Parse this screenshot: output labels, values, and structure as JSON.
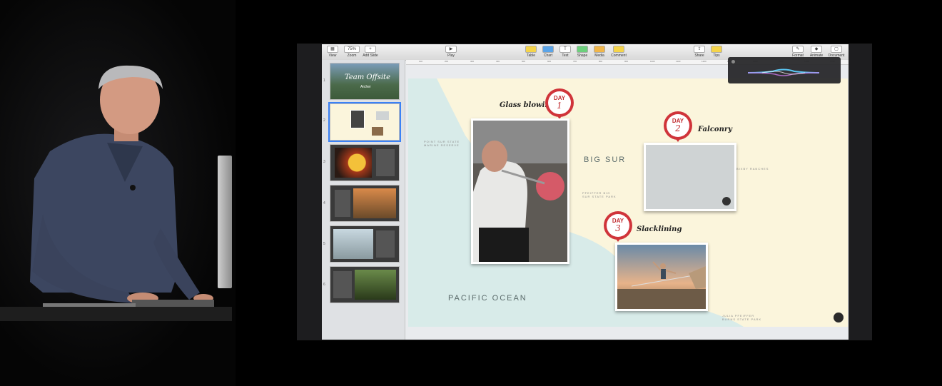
{
  "toolbar": {
    "left": [
      {
        "label": "View",
        "icon": "view-icon"
      },
      {
        "label": "Zoom",
        "value": "75%"
      },
      {
        "label": "Add Slide",
        "icon": "plus-icon"
      }
    ],
    "center_play": {
      "label": "Play",
      "icon": "play-icon"
    },
    "insert": [
      {
        "label": "Table",
        "icon": "table-icon"
      },
      {
        "label": "Chart",
        "icon": "chart-icon"
      },
      {
        "label": "Text",
        "icon": "text-icon",
        "glyph": "T"
      },
      {
        "label": "Shape",
        "icon": "shape-icon"
      },
      {
        "label": "Media",
        "icon": "media-icon"
      },
      {
        "label": "Comment",
        "icon": "comment-icon"
      }
    ],
    "right": [
      {
        "label": "Share",
        "icon": "share-icon"
      },
      {
        "label": "Tips",
        "icon": "tips-icon"
      }
    ],
    "inspector": [
      {
        "label": "Format",
        "icon": "format-icon"
      },
      {
        "label": "Animate",
        "icon": "animate-icon"
      },
      {
        "label": "Document",
        "icon": "document-icon"
      }
    ]
  },
  "ruler": {
    "ticks": [
      "100",
      "200",
      "300",
      "400",
      "500",
      "600",
      "700",
      "800",
      "900",
      "1000",
      "1100",
      "1200",
      "1300",
      "1400",
      "1500",
      "1600",
      "1700"
    ]
  },
  "navigator": {
    "slides": [
      {
        "number": "1",
        "title": "Team Offsite",
        "subtitle": "Archer"
      },
      {
        "number": "2"
      },
      {
        "number": "3"
      },
      {
        "number": "4"
      },
      {
        "number": "5"
      },
      {
        "number": "6"
      }
    ]
  },
  "slide": {
    "region_big": "BIG SUR",
    "ocean": "PACIFIC OCEAN",
    "small_labels": [
      "POINT SUR STATE MARINE RESERVE",
      "PFEIFFER BIG SUR STATE PARK",
      "BIXBY RANCHES",
      "JULIA PFEIFFER BURNS STATE PARK"
    ],
    "days": [
      {
        "day": "DAY",
        "number": "1",
        "activity": "Glass blowing"
      },
      {
        "day": "DAY",
        "number": "2",
        "activity": "Falconry"
      },
      {
        "day": "DAY",
        "number": "3",
        "activity": "Slacklining"
      }
    ]
  },
  "colors": {
    "accent": "#d0343a",
    "map_land": "#fbf5dc",
    "map_water": "#d8ebe9",
    "selection": "#3b82f6"
  }
}
